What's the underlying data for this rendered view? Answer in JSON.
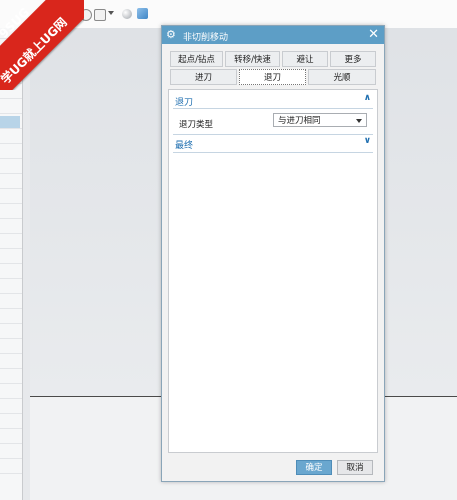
{
  "dialog": {
    "title": "非切削移动",
    "tabs_row1": [
      "起点/钻点",
      "转移/快速",
      "避让",
      "更多"
    ],
    "tabs_row2": [
      "进刀",
      "退刀",
      "光顺"
    ],
    "active_tab": "退刀",
    "retract_group": {
      "title": "退刀",
      "field_label": "退刀类型",
      "field_value": "与进刀相同"
    },
    "finish_group": {
      "title": "最终"
    },
    "ok_label": "确定",
    "cancel_label": "取消",
    "accent_color": "#5d9ec6"
  },
  "watermark": {
    "line1": "9SUG",
    "line2": "学UG就上UG网"
  },
  "toolbar_icons": [
    "circle-icon",
    "square-select-icon",
    "dropdown-arrow-icon",
    "sphere-icon",
    "cube-icon"
  ]
}
